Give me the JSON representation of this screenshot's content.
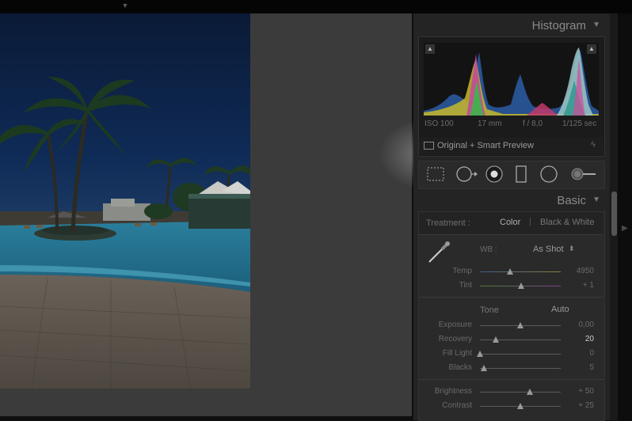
{
  "histogram": {
    "title": "Histogram",
    "exif": {
      "iso": "ISO 100",
      "focal": "17 mm",
      "aperture": "f / 8,0",
      "shutter": "1/125 sec"
    },
    "preview_label": "Original + Smart Preview"
  },
  "tools": [
    "crop-overlay-icon",
    "spot-removal-icon",
    "red-eye-icon",
    "graduated-filter-icon",
    "radial-filter-icon",
    "adjustment-brush-icon"
  ],
  "basic": {
    "title": "Basic",
    "treatment_label": "Treatment :",
    "treatment_color": "Color",
    "treatment_bw": "Black & White",
    "wb_label": "WB :",
    "wb_value": "As Shot",
    "wb_arrow": "⬍",
    "temp_label": "Temp",
    "temp_value": "4950",
    "temp_level": 0.37,
    "tint_label": "Tint",
    "tint_value": "+ 1",
    "tint_level": 0.51,
    "tone_label": "Tone",
    "auto_label": "Auto",
    "sliders": [
      {
        "label": "Exposure",
        "value": "0,00",
        "level": 0.5
      },
      {
        "label": "Recovery",
        "value": "20",
        "level": 0.2
      },
      {
        "label": "Fill Light",
        "value": "0",
        "level": 0.0
      },
      {
        "label": "Blacks",
        "value": "5",
        "level": 0.05
      }
    ],
    "sliders2": [
      {
        "label": "Brightness",
        "value": "+ 50",
        "level": 0.62
      },
      {
        "label": "Contrast",
        "value": "+ 25",
        "level": 0.5
      }
    ]
  }
}
